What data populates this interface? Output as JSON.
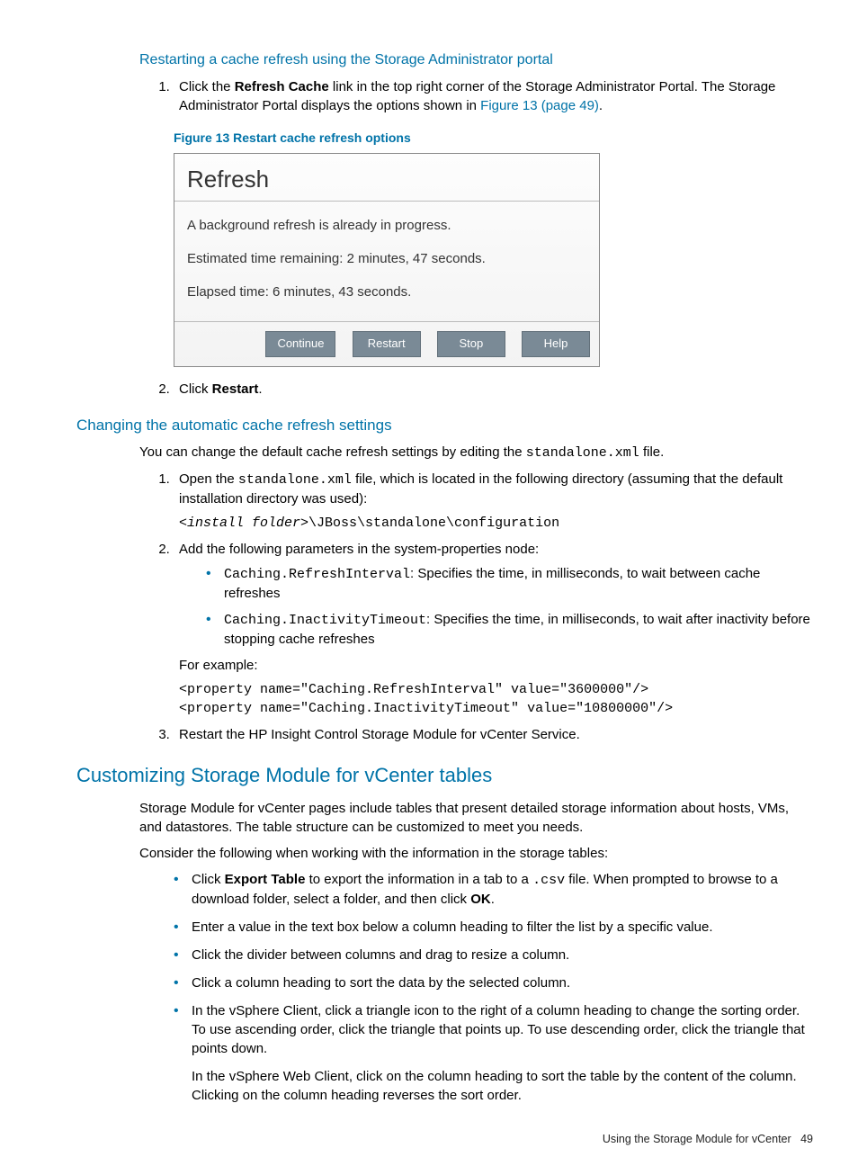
{
  "h4_restart": "Restarting a cache refresh using the Storage Administrator portal",
  "step1_a": "Click the ",
  "step1_bold": "Refresh Cache",
  "step1_b": " link in the top right corner of the Storage Administrator Portal. The Storage Administrator Portal displays the options shown in ",
  "step1_link": "Figure 13 (page 49)",
  "step1_c": ".",
  "figcaption": "Figure 13 Restart cache refresh options",
  "dialog": {
    "title": "Refresh",
    "line1": "A background refresh is already in progress.",
    "line2": "Estimated time remaining: 2 minutes, 47 seconds.",
    "line3": "Elapsed time: 6 minutes, 43 seconds.",
    "btn_continue": "Continue",
    "btn_restart": "Restart",
    "btn_stop": "Stop",
    "btn_help": "Help"
  },
  "step2_a": "Click ",
  "step2_bold": "Restart",
  "step2_b": ".",
  "h3_change": "Changing the automatic cache refresh settings",
  "para_change_a": "You can change the default cache refresh settings by editing the ",
  "para_change_code": "standalone.xml",
  "para_change_b": " file.",
  "c_step1_a": "Open the ",
  "c_step1_code": "standalone.xml",
  "c_step1_b": " file, which is located in the following directory (assuming that the default installation directory was used):",
  "c_step1_path_a": "<install folder>",
  "c_step1_path_b": "\\JBoss\\standalone\\configuration",
  "c_step2": "Add the following parameters in the system-properties node:",
  "c_step2_b1_code": "Caching.RefreshInterval",
  "c_step2_b1_text": ": Specifies the time, in milliseconds, to wait between cache refreshes",
  "c_step2_b2_code": "Caching.InactivityTimeout",
  "c_step2_b2_text": ": Specifies the time, in milliseconds, to wait after inactivity before stopping cache refreshes",
  "c_step2_example": "For example:",
  "c_step2_codeblock": "<property name=\"Caching.RefreshInterval\" value=\"3600000\"/>\n<property name=\"Caching.InactivityTimeout\" value=\"10800000\"/>",
  "c_step3": "Restart the HP Insight Control Storage Module for vCenter Service.",
  "h2_custom": "Customizing Storage Module for vCenter tables",
  "cust_para1": "Storage Module for vCenter pages include tables that present detailed storage information about hosts, VMs, and datastores. The table structure can be customized to meet you needs.",
  "cust_para2": "Consider the following when working with the information in the storage tables:",
  "cust_b1_a": "Click ",
  "cust_b1_bold": "Export Table",
  "cust_b1_b": " to export the information in a tab to a ",
  "cust_b1_code": ".csv",
  "cust_b1_c": " file. When prompted to browse to a download folder, select a folder, and then click ",
  "cust_b1_bold2": "OK",
  "cust_b1_d": ".",
  "cust_b2": "Enter a value in the text box below a column heading to filter the list by a specific value.",
  "cust_b3": "Click the divider between columns and drag to resize a column.",
  "cust_b4": "Click a column heading to sort the data by the selected column.",
  "cust_b5_a": "In the vSphere Client, click a triangle icon to the right of a column heading to change the sorting order. To use ascending order, click the triangle that points up. To use descending order, click the triangle that points down.",
  "cust_b5_b": "In the vSphere Web Client, click on the column heading to sort the table by the content of the column. Clicking on the column heading reverses the sort order.",
  "footer_text": "Using the Storage Module for vCenter",
  "footer_page": "49"
}
